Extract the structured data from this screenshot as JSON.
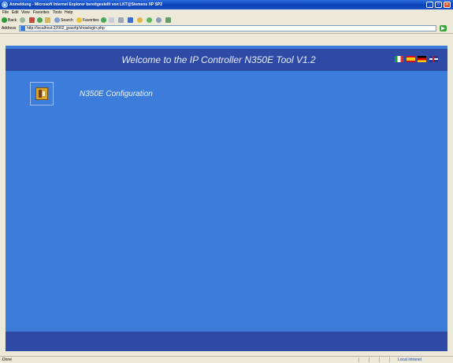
{
  "window": {
    "title": "Anmeldung - Microsoft Internet Explorer bereitgestellt von LKT@Siemens XP SP2"
  },
  "menu": {
    "items": [
      "File",
      "Edit",
      "View",
      "Favorites",
      "Tools",
      "Help"
    ]
  },
  "toolbar": {
    "back_label": "Back",
    "search_label": "Search",
    "favorites_label": "Favorites"
  },
  "address": {
    "label": "Address",
    "url": "http://localhost:32002_jpasrfg/showlogin.php"
  },
  "page": {
    "welcome": "Welcome to the IP Controller N350E Tool V1.2",
    "languages": [
      "it",
      "es",
      "de",
      "en"
    ],
    "config_label": "N350E Configuration",
    "colors": {
      "background": "#3c7ddc",
      "band": "#2e4aa4"
    }
  },
  "status": {
    "text": "Done",
    "zone": "Local intranet"
  }
}
